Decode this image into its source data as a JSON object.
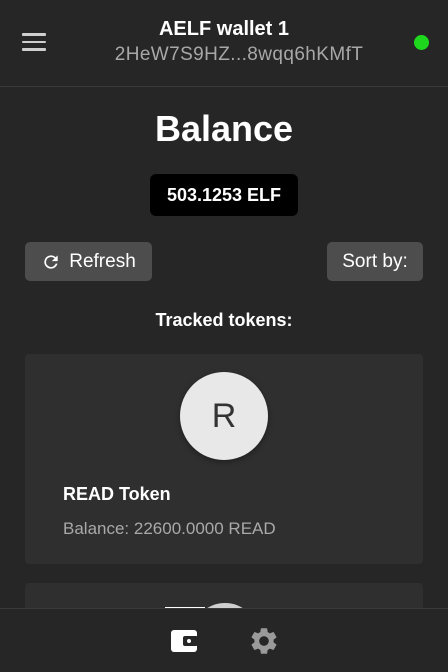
{
  "header": {
    "wallet_name": "AELF wallet 1",
    "wallet_address": "2HeW7S9HZ...8wqq6hKMfT",
    "status_color": "#1ed81e",
    "menu_icon": "hamburger-menu-icon"
  },
  "main": {
    "title": "Balance",
    "balance": "503.1253 ELF",
    "refresh_label": "Refresh",
    "sort_label": "Sort by:",
    "tracked_label": "Tracked tokens:"
  },
  "tokens": [
    {
      "initial": "R",
      "name": "READ Token",
      "balance": "Balance: 22600.0000 READ"
    }
  ],
  "bottom_nav": {
    "items": [
      {
        "icon": "wallet-icon",
        "active": true
      },
      {
        "icon": "gear-icon",
        "active": false
      }
    ]
  },
  "colors": {
    "background": "#262626",
    "card": "#2f2f2f",
    "button": "#4d4d4d",
    "balance_pill": "#000000"
  }
}
